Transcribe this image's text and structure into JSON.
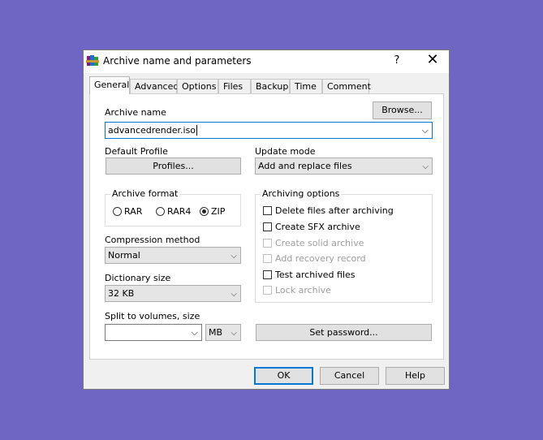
{
  "dialog": {
    "title": "Archive name and parameters",
    "help_label": "?",
    "close_label": "✕"
  },
  "tabs": [
    {
      "label": "General"
    },
    {
      "label": "Advanced"
    },
    {
      "label": "Options"
    },
    {
      "label": "Files"
    },
    {
      "label": "Backup"
    },
    {
      "label": "Time"
    },
    {
      "label": "Comment"
    }
  ],
  "general": {
    "archive_name_label": "Archive name",
    "browse_label": "Browse...",
    "archive_name_value": "advancedrender.iso",
    "default_profile_label": "Default Profile",
    "profiles_label": "Profiles...",
    "update_mode_label": "Update mode",
    "update_mode_value": "Add and replace files",
    "archive_format_label": "Archive format",
    "formats": [
      "RAR",
      "RAR4",
      "ZIP"
    ],
    "selected_format": "ZIP",
    "compression_method_label": "Compression method",
    "compression_method_value": "Normal",
    "dictionary_size_label": "Dictionary size",
    "dictionary_size_value": "32 KB",
    "split_label": "Split to volumes, size",
    "split_value": "",
    "split_unit": "MB",
    "archiving_options_label": "Archiving options",
    "options": [
      {
        "label": "Delete files after archiving",
        "checked": false,
        "enabled": true
      },
      {
        "label": "Create SFX archive",
        "checked": false,
        "enabled": true
      },
      {
        "label": "Create solid archive",
        "checked": false,
        "enabled": false
      },
      {
        "label": "Add recovery record",
        "checked": false,
        "enabled": false
      },
      {
        "label": "Test archived files",
        "checked": false,
        "enabled": true
      },
      {
        "label": "Lock archive",
        "checked": false,
        "enabled": false
      }
    ],
    "set_password_label": "Set password..."
  },
  "footer": {
    "ok_label": "OK",
    "cancel_label": "Cancel",
    "help_label": "Help"
  },
  "icons": {
    "app": "winrar-books-icon",
    "chevron": "chevron-down-icon"
  }
}
